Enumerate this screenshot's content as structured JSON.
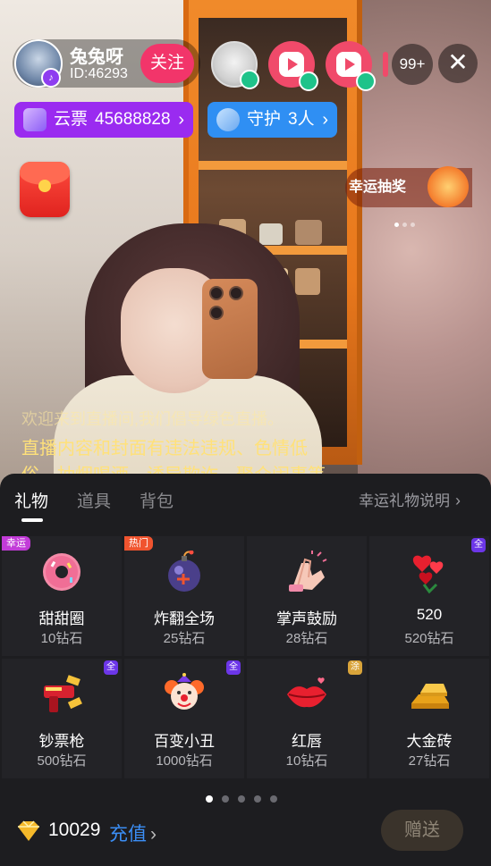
{
  "host": {
    "name": "兔兔呀",
    "id_label": "ID:46293",
    "follow_label": "关注"
  },
  "viewers": {
    "count_label": "99+"
  },
  "pills": {
    "ticket_label": "云票",
    "ticket_value": "45688828",
    "guard_label": "守护",
    "guard_value": "3人"
  },
  "lucky_draw": {
    "label": "幸运抽奖"
  },
  "chat": {
    "welcome": "欢迎来到直播间,我们倡导绿色直播。",
    "notice": "直播内容和封面有违法违规、色情低俗、抽烟喝酒、诱导欺诈、聚众闹事等"
  },
  "gift_panel": {
    "tabs": [
      {
        "label": "礼物"
      },
      {
        "label": "道具"
      },
      {
        "label": "背包"
      }
    ],
    "description_link": "幸运礼物说明",
    "gifts": [
      {
        "name": "甜甜圈",
        "price": "10钻石",
        "tag": "幸运",
        "corner": "",
        "icon": "donut-icon"
      },
      {
        "name": "炸翻全场",
        "price": "25钻石",
        "tag": "热门",
        "corner": "",
        "icon": "bomb-icon"
      },
      {
        "name": "掌声鼓励",
        "price": "28钻石",
        "tag": "",
        "corner": "",
        "icon": "clapping-hands-icon"
      },
      {
        "name": "520",
        "price": "520钻石",
        "tag": "",
        "corner": "全",
        "icon": "hearts-bouquet-icon"
      },
      {
        "name": "钞票枪",
        "price": "500钻石",
        "tag": "",
        "corner": "全",
        "icon": "money-gun-icon"
      },
      {
        "name": "百变小丑",
        "price": "1000钻石",
        "tag": "",
        "corner": "全",
        "icon": "clown-icon"
      },
      {
        "name": "红唇",
        "price": "10钻石",
        "tag": "",
        "corner": "",
        "icon": "red-lips-icon"
      },
      {
        "name": "大金砖",
        "price": "27钻石",
        "tag": "",
        "corner": "涂",
        "icon": "gold-bars-icon"
      }
    ],
    "page_count": 5,
    "current_page": 1
  },
  "footer": {
    "balance": "10029",
    "recharge_label": "充值",
    "send_label": "赠送"
  },
  "colors": {
    "follow": "#f2356a",
    "ticket_pill": "#9a2bf0",
    "guard_pill": "#2f8ff3",
    "recharge": "#3b8ef5",
    "notice_text": "#ffe17a"
  }
}
